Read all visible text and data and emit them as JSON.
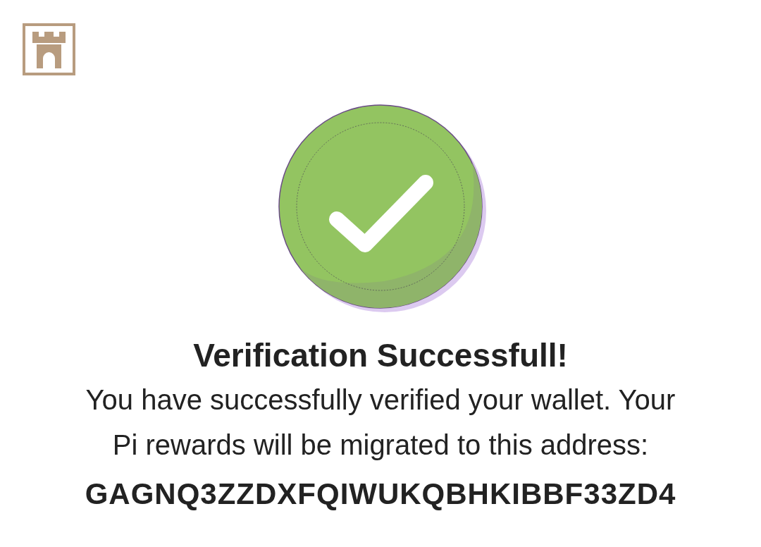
{
  "title": "Verification Successfull!",
  "message": "You have successfully verified your wallet. Your Pi rewards will be migrated to this address:",
  "address": "GAGNQ3ZZDXFQIWUKQBHKIBBF33ZD4"
}
